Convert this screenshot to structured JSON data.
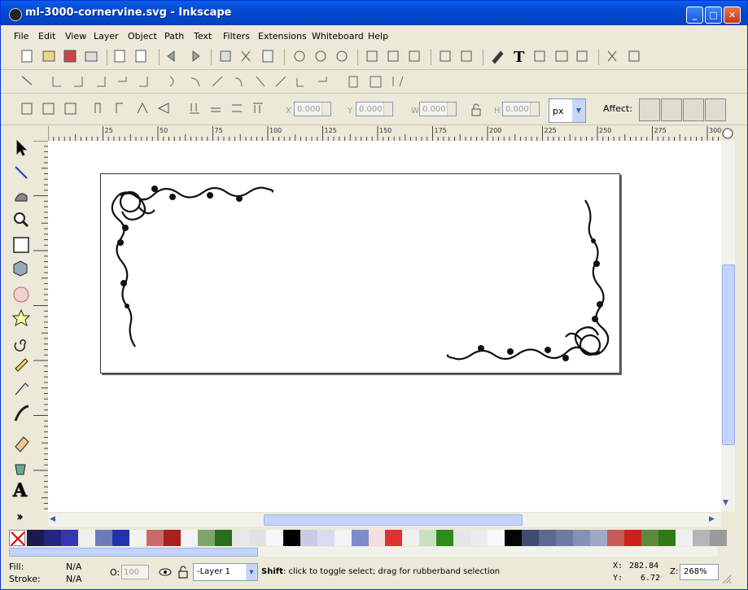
{
  "window": {
    "title": "ml-3000-cornervine.svg - Inkscape"
  },
  "menu": [
    "File",
    "Edit",
    "View",
    "Layer",
    "Object",
    "Path",
    "Text",
    "Filters",
    "Extensions",
    "Whiteboard",
    "Help"
  ],
  "toolbar_select": {
    "x": "0.000",
    "y": "0.000",
    "w": "0.000",
    "h": "0.000",
    "unit": "px",
    "affect_label": "Affect:"
  },
  "rulers": {
    "h_labels": [
      "25",
      "50",
      "75",
      "100",
      "125",
      "150",
      "175",
      "200",
      "225",
      "250",
      "275",
      "300"
    ]
  },
  "status": {
    "fill_label": "Fill:",
    "fill_value": "N/A",
    "stroke_label": "Stroke:",
    "stroke_value": "N/A",
    "opacity_label": "O:",
    "opacity_value": "100",
    "layer": "-Layer 1",
    "hint_bold": "Shift",
    "hint_text": ": click to toggle select; drag for rubberband selection",
    "x_label": "X:",
    "x_value": "282.84",
    "y_label": "Y:",
    "y_value": "6.72",
    "zoom_label": "Z:",
    "zoom_value": "268%"
  },
  "palette_colors": [
    "#1a1a4f",
    "#252586",
    "#3535b5",
    "#f0f0f0",
    "#6c7ab8",
    "#2332b0",
    "#f2f2f2",
    "#c86a6a",
    "#aa1f1f",
    "#f3f3f3",
    "#7fa46a",
    "#2a6e1a",
    "#e8e8e8",
    "#e2e2e2",
    "#f7f7f7",
    "#000000",
    "#c8cae6",
    "#d9dbf0",
    "#f2f2f7",
    "#7f8ccc",
    "#f4dede",
    "#e03030",
    "#f0f0f0",
    "#c8e0c0",
    "#2e8b1e",
    "#e6e6e6",
    "#ececec",
    "#f9f9f9",
    "#050505",
    "#3d4d72",
    "#5a6a90",
    "#6b7ba1",
    "#8292b7",
    "#a0a8c8",
    "#c85a5a",
    "#cf2020",
    "#5a8a3a",
    "#2e7a14",
    "#f0f0f0",
    "#b5b5b5",
    "#9a9a9a"
  ]
}
